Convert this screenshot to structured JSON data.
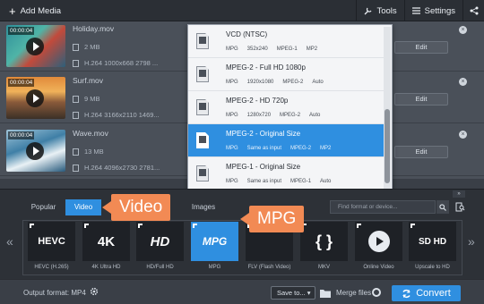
{
  "toolbar": {
    "add_media_label": "Add Media",
    "tools_label": "Tools",
    "settings_label": "Settings"
  },
  "files": [
    {
      "name": "Holiday.mov",
      "duration": "00:00:04",
      "size": "2 MB",
      "codec": "H.264 1000x668 2798 ...",
      "edit_label": "Edit"
    },
    {
      "name": "Surf.mov",
      "duration": "00:00:04",
      "size": "9 MB",
      "codec": "H.264 3166x2110 1469...",
      "edit_label": "Edit"
    },
    {
      "name": "Wave.mov",
      "duration": "00:00:04",
      "size": "13 MB",
      "codec": "H.264 4096x2730 2781...",
      "edit_label": "Edit"
    }
  ],
  "dropdown": {
    "options": [
      {
        "title": "VCD (NTSC)",
        "tags": [
          "MPG",
          "352x240",
          "MPEG-1",
          "MP2"
        ]
      },
      {
        "title": "MPEG-2 - Full HD 1080p",
        "tags": [
          "MPG",
          "1920x1080",
          "MPEG-2",
          "Auto"
        ]
      },
      {
        "title": "MPEG-2 - HD 720p",
        "tags": [
          "MPG",
          "1280x720",
          "MPEG-2",
          "Auto"
        ]
      },
      {
        "title": "MPEG-2 - Original Size",
        "tags": [
          "MPG",
          "Same as input",
          "MPEG-2",
          "MP2"
        ]
      },
      {
        "title": "MPEG-1 - Original Size",
        "tags": [
          "MPG",
          "Same as input",
          "MPEG-1",
          "Auto"
        ]
      }
    ],
    "selected_index": 3
  },
  "format_tabs": {
    "popular": "Popular",
    "video": "Video",
    "images": "Images",
    "search_placeholder": "Find format or device..."
  },
  "callouts": {
    "video": "Video",
    "mpg": "MPG"
  },
  "format_tiles": [
    {
      "art": "HEVC",
      "label": "HEVC (H.265)"
    },
    {
      "art": "4K",
      "label": "4K Ultra HD"
    },
    {
      "art": "HD",
      "label": "HD/Full HD"
    },
    {
      "art": "MPG",
      "label": "MPG"
    },
    {
      "art": "",
      "label": "FLV (Flash Video)"
    },
    {
      "art": "{ }",
      "label": "MKV"
    },
    {
      "art": "",
      "label": "Online Video"
    },
    {
      "art": "SD HD",
      "label": "Upscale to HD"
    }
  ],
  "bottom": {
    "output_format": "Output format: MP4",
    "save_to": "Save to...",
    "merge_files": "Merge files",
    "convert": "Convert"
  },
  "colors": {
    "accent": "#2f8fe0",
    "callout": "#f28a54"
  }
}
